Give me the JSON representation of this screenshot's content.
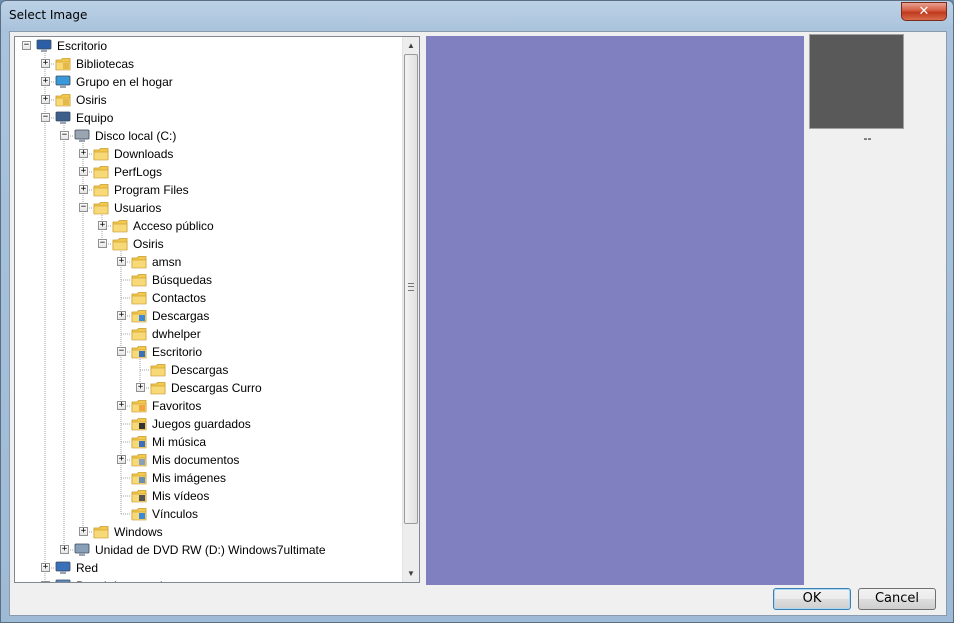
{
  "window": {
    "title": "Select Image",
    "close_glyph": "✕"
  },
  "tree": {
    "nodes": [
      {
        "label": "Escritorio",
        "level": 0,
        "expander": "minus",
        "icon": "desktop-icon",
        "color": "#2a5fa8"
      },
      {
        "label": "Bibliotecas",
        "level": 1,
        "expander": "plus",
        "icon": "libraries-icon",
        "color": "#e5b84a"
      },
      {
        "label": "Grupo en el hogar",
        "level": 1,
        "expander": "plus",
        "icon": "homegroup-icon",
        "color": "#3a9ad9"
      },
      {
        "label": "Osiris",
        "level": 1,
        "expander": "plus",
        "icon": "user-folder-icon",
        "color": "#e5b84a"
      },
      {
        "label": "Equipo",
        "level": 1,
        "expander": "minus",
        "icon": "computer-icon",
        "color": "#3c5f8c"
      },
      {
        "label": "Disco local (C:)",
        "level": 2,
        "expander": "minus",
        "icon": "local-disk-icon",
        "color": "#9aa5b1"
      },
      {
        "label": "Downloads",
        "level": 3,
        "expander": "plus",
        "icon": "folder-icon",
        "color": "#f2c94c"
      },
      {
        "label": "PerfLogs",
        "level": 3,
        "expander": "plus",
        "icon": "folder-icon",
        "color": "#f2c94c"
      },
      {
        "label": "Program Files",
        "level": 3,
        "expander": "plus",
        "icon": "folder-icon",
        "color": "#f2c94c"
      },
      {
        "label": "Usuarios",
        "level": 3,
        "expander": "minus",
        "icon": "folder-icon",
        "color": "#f2c94c"
      },
      {
        "label": "Acceso público",
        "level": 4,
        "expander": "plus",
        "icon": "folder-icon",
        "color": "#f2c94c"
      },
      {
        "label": "Osiris",
        "level": 4,
        "expander": "minus",
        "icon": "folder-icon",
        "color": "#f2c94c"
      },
      {
        "label": "amsn",
        "level": 5,
        "expander": "plus",
        "icon": "folder-icon",
        "color": "#f2c94c"
      },
      {
        "label": "Búsquedas",
        "level": 5,
        "expander": "none",
        "icon": "searches-folder-icon",
        "color": "#f2c94c"
      },
      {
        "label": "Contactos",
        "level": 5,
        "expander": "none",
        "icon": "contacts-folder-icon",
        "color": "#f2c94c"
      },
      {
        "label": "Descargas",
        "level": 5,
        "expander": "plus",
        "icon": "downloads-folder-icon",
        "color": "#3a8ad9"
      },
      {
        "label": "dwhelper",
        "level": 5,
        "expander": "none",
        "icon": "folder-icon",
        "color": "#f2c94c"
      },
      {
        "label": "Escritorio",
        "level": 5,
        "expander": "minus",
        "icon": "desktop-folder-icon",
        "color": "#3a6fb9"
      },
      {
        "label": "Descargas",
        "level": 6,
        "expander": "none",
        "icon": "folder-icon",
        "color": "#f2c94c"
      },
      {
        "label": "Descargas Curro",
        "level": 6,
        "expander": "plus",
        "icon": "folder-icon",
        "color": "#f2c94c"
      },
      {
        "label": "Favoritos",
        "level": 5,
        "expander": "plus",
        "icon": "favorites-folder-icon",
        "color": "#f2a53c"
      },
      {
        "label": "Juegos guardados",
        "level": 5,
        "expander": "none",
        "icon": "saved-games-folder-icon",
        "color": "#333333"
      },
      {
        "label": "Mi música",
        "level": 5,
        "expander": "none",
        "icon": "music-folder-icon",
        "color": "#3a6fb9"
      },
      {
        "label": "Mis documentos",
        "level": 5,
        "expander": "plus",
        "icon": "documents-folder-icon",
        "color": "#8aa0b8"
      },
      {
        "label": "Mis imágenes",
        "level": 5,
        "expander": "none",
        "icon": "pictures-folder-icon",
        "color": "#6b8fb3"
      },
      {
        "label": "Mis vídeos",
        "level": 5,
        "expander": "none",
        "icon": "videos-folder-icon",
        "color": "#555555"
      },
      {
        "label": "Vínculos",
        "level": 5,
        "expander": "none",
        "icon": "links-folder-icon",
        "color": "#3a8ad9"
      },
      {
        "label": "Windows",
        "level": 3,
        "expander": "plus",
        "icon": "folder-icon",
        "color": "#f2c94c"
      },
      {
        "label": "Unidad de DVD RW (D:) Windows7ultimate",
        "level": 2,
        "expander": "plus",
        "icon": "dvd-drive-icon",
        "color": "#8aa0b8"
      },
      {
        "label": "Red",
        "level": 1,
        "expander": "plus",
        "icon": "network-icon",
        "color": "#3a6fb9"
      },
      {
        "label": "Panel de control",
        "level": 1,
        "expander": "plus",
        "icon": "control-panel-icon",
        "color": "#5a8ac0"
      }
    ],
    "scroll_up_glyph": "▲",
    "scroll_down_glyph": "▼"
  },
  "preview": {
    "color": "#8080c0"
  },
  "thumbnail": {
    "color": "#595959",
    "caption": "--"
  },
  "buttons": {
    "ok_label": "OK",
    "cancel_label": "Cancel"
  }
}
